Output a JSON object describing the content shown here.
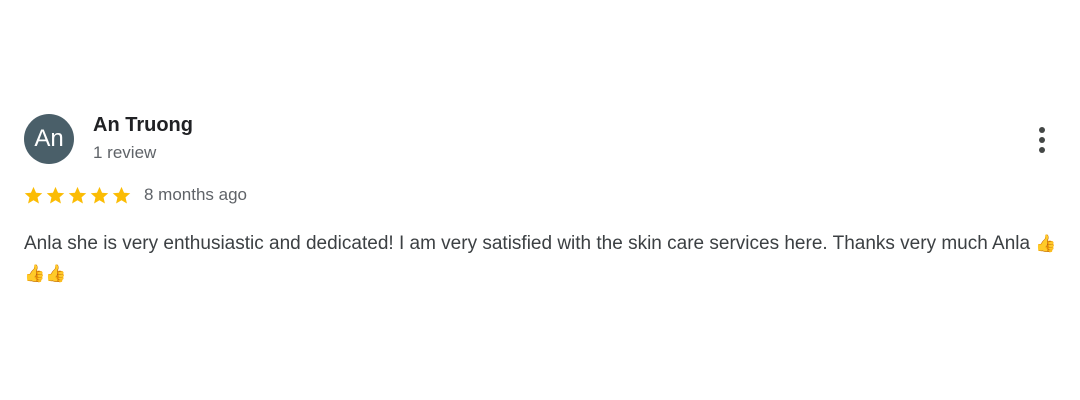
{
  "review": {
    "author": {
      "initials": "An",
      "name": "An Truong",
      "review_count": "1 review"
    },
    "rating": 5,
    "rating_max": 5,
    "time": "8 months ago",
    "text": "Anla she is very enthusiastic and dedicated! I am very satisfied with the skin care services here. Thanks very much Anla",
    "emoji": "👍👍👍"
  },
  "icons": {
    "more": "more-vert-icon",
    "star": "star-icon"
  },
  "colors": {
    "avatar_bg": "#4a5f69",
    "star": "#fbbc04",
    "name": "#202124",
    "secondary_text": "#5f6368",
    "body_text": "#3c4043"
  }
}
